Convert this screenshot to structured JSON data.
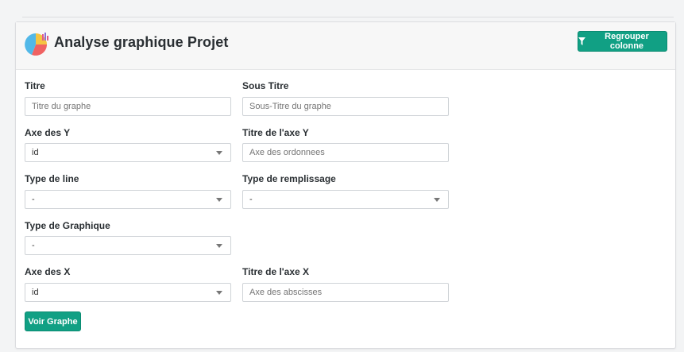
{
  "header": {
    "title": "Analyse graphique Projet",
    "icon": "pie-chart-icon",
    "group_button_label": "Regrouper colonne",
    "group_button_icon": "filter-icon"
  },
  "form": {
    "titre": {
      "label": "Titre",
      "placeholder": "Titre du graphe"
    },
    "sous_titre": {
      "label": "Sous Titre",
      "placeholder": "Sous-Titre du graphe"
    },
    "axe_y": {
      "label": "Axe des Y",
      "value": "id"
    },
    "titre_axe_y": {
      "label": "Titre de l'axe Y",
      "placeholder": "Axe des ordonnees"
    },
    "type_line": {
      "label": "Type de line",
      "value": "-"
    },
    "type_remplissage": {
      "label": "Type de remplissage",
      "value": "-"
    },
    "type_graphique": {
      "label": "Type de Graphique",
      "value": "-"
    },
    "axe_x": {
      "label": "Axe des X",
      "value": "id"
    },
    "titre_axe_x": {
      "label": "Titre de l'axe X",
      "placeholder": "Axe des abscisses"
    },
    "submit_label": "Voir Graphe"
  },
  "colors": {
    "accent": "#11a084",
    "header_bg": "#f7f7f7",
    "page_bg": "#f3f4f5"
  }
}
